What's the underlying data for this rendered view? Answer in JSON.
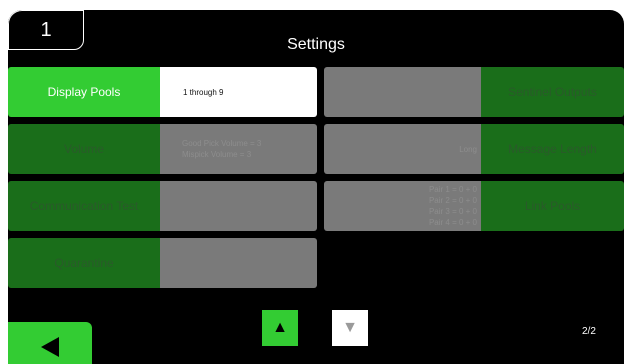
{
  "header": {
    "badge": "1",
    "title": "Settings"
  },
  "rows": [
    {
      "label": "Display Pools",
      "value": "1 through 9"
    },
    {
      "label": "Volume",
      "value_lines": [
        "Good Pick Volume = 3",
        "Mispick Volume = 3"
      ]
    },
    {
      "label": "Communication Test",
      "value": ""
    },
    {
      "label": "Quarantine",
      "value": ""
    },
    {
      "label": "Sentinel Outputs",
      "value": ""
    },
    {
      "label": "Message Length",
      "value": "Long"
    },
    {
      "label": "Link Pools",
      "value_lines": [
        "Pair 1 = 0 + 0",
        "Pair 2 = 0 + 0",
        "Pair 3 = 0 + 0",
        "Pair 4 = 0 + 0"
      ]
    }
  ],
  "nav": {
    "up_icon": "triangle-up-icon",
    "down_icon": "triangle-down-icon",
    "back_icon": "triangle-left-icon"
  },
  "footer": {
    "page_indicator": "2/2"
  },
  "colors": {
    "active_green": "#33cc33",
    "inactive_green": "#1a6e1a",
    "inactive_gray": "#7a7a7a",
    "background": "#000000"
  }
}
